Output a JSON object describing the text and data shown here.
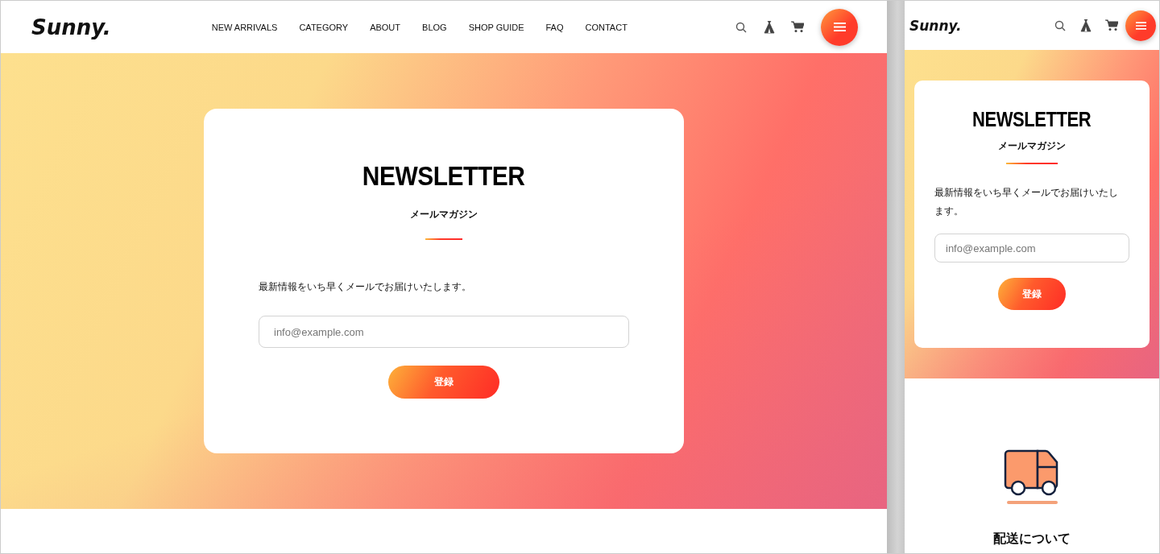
{
  "desktop": {
    "header": {
      "logo": "Sunny.",
      "nav": [
        "NEW ARRIVALS",
        "CATEGORY",
        "ABOUT",
        "BLOG",
        "SHOP GUIDE",
        "FAQ",
        "CONTACT"
      ]
    },
    "newsletter": {
      "title": "NEWSLETTER",
      "subtitle": "メールマガジン",
      "description": "最新情報をいち早くメールでお届けいたします。",
      "email_placeholder": "info@example.com",
      "button": "登録"
    }
  },
  "mobile": {
    "header": {
      "logo": "Sunny."
    },
    "newsletter": {
      "title": "NEWSLETTER",
      "subtitle": "メールマガジン",
      "description": "最新情報をいち早くメールでお届けいたします。",
      "email_placeholder": "info@example.com",
      "button": "登録"
    },
    "shipping": {
      "title": "配送について"
    }
  }
}
